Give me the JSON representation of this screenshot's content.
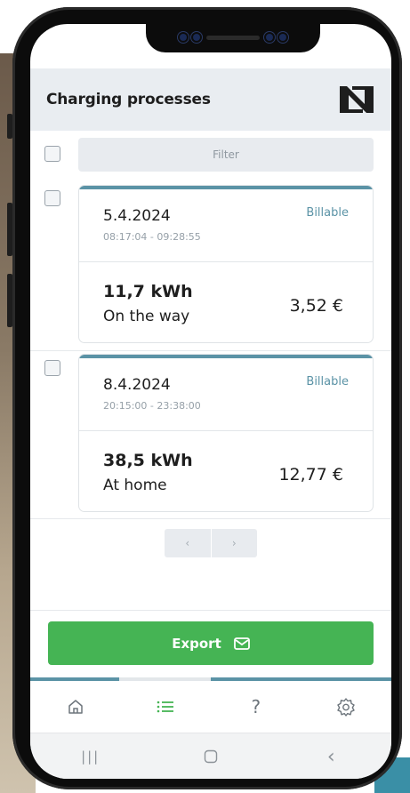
{
  "header": {
    "title": "Charging processes",
    "logo": "nlogo-icon"
  },
  "filter": {
    "label": "Filter"
  },
  "sessions": [
    {
      "date": "5.4.2024",
      "time": "08:17:04 - 09:28:55",
      "badge": "Billable",
      "energy": "11,7 kWh",
      "location": "On the way",
      "price": "3,52 €"
    },
    {
      "date": "8.4.2024",
      "time": "20:15:00 - 23:38:00",
      "badge": "Billable",
      "energy": "38,5 kWh",
      "location": "At home",
      "price": "12,77 €"
    }
  ],
  "pagination": {
    "prev": "‹",
    "next": "›"
  },
  "export": {
    "label": "Export",
    "icon": "mail-icon"
  },
  "tabs": [
    {
      "id": "home",
      "icon": "home-icon"
    },
    {
      "id": "list",
      "icon": "list-icon",
      "active": true
    },
    {
      "id": "help",
      "icon": "help-icon",
      "label": "?"
    },
    {
      "id": "settings",
      "icon": "gear-icon"
    }
  ],
  "system_nav": {
    "recents": "|||",
    "back": "‹"
  },
  "colors": {
    "accent": "#5b93a6",
    "primary": "#45b454",
    "header_bg": "#e9edf1",
    "active_tab": "#45b454",
    "text": "#1e1e1e"
  }
}
